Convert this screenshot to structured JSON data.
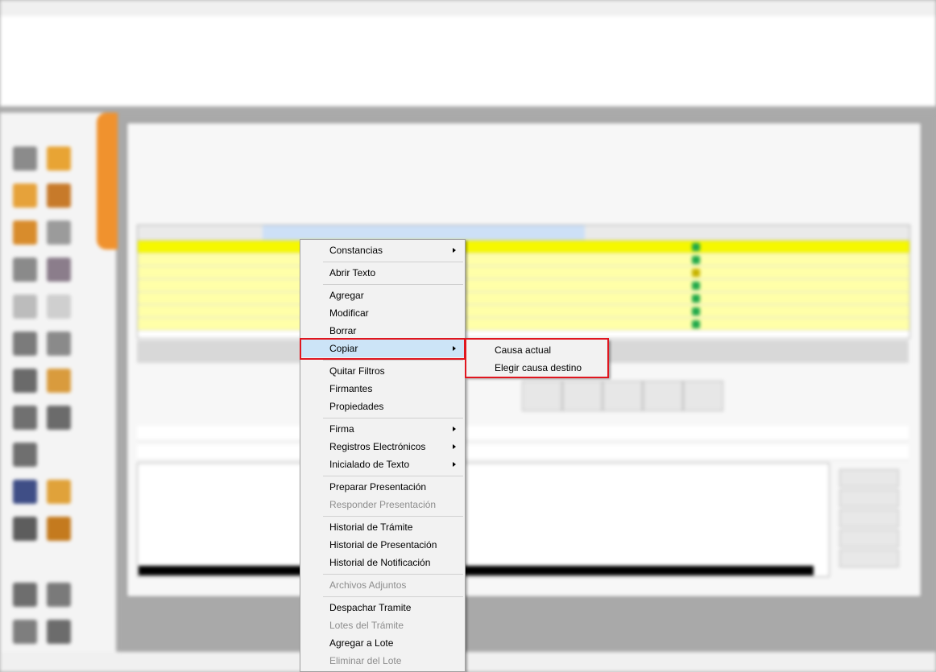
{
  "context_menu": {
    "items": [
      {
        "label": "Constancias",
        "submenu": true,
        "enabled": true
      },
      {
        "label": "Abrir Texto",
        "enabled": true
      },
      {
        "label": "Agregar",
        "enabled": true
      },
      {
        "label": "Modificar",
        "enabled": true
      },
      {
        "label": "Borrar",
        "enabled": true
      },
      {
        "label": "Copiar",
        "submenu": true,
        "enabled": true,
        "highlighted": true
      },
      {
        "label": "Quitar Filtros",
        "enabled": true
      },
      {
        "label": "Firmantes",
        "enabled": true
      },
      {
        "label": "Propiedades",
        "enabled": true
      },
      {
        "label": "Firma",
        "submenu": true,
        "enabled": true
      },
      {
        "label": "Registros Electrónicos",
        "submenu": true,
        "enabled": true
      },
      {
        "label": "Inicialado de Texto",
        "submenu": true,
        "enabled": true
      },
      {
        "label": "Preparar Presentación",
        "enabled": true
      },
      {
        "label": "Responder Presentación",
        "enabled": false
      },
      {
        "label": "Historial de Trámite",
        "enabled": true
      },
      {
        "label": "Historial de Presentación",
        "enabled": true
      },
      {
        "label": "Historial de Notificación",
        "enabled": true
      },
      {
        "label": "Archivos Adjuntos",
        "enabled": false
      },
      {
        "label": "Despachar Tramite",
        "enabled": true
      },
      {
        "label": "Lotes del Trámite",
        "enabled": false
      },
      {
        "label": "Agregar a Lote",
        "enabled": true
      },
      {
        "label": "Eliminar del Lote",
        "enabled": false
      }
    ]
  },
  "submenu_copiar": {
    "items": [
      {
        "label": "Causa actual"
      },
      {
        "label": "Elegir causa destino"
      }
    ]
  },
  "colors": {
    "highlight": "#cce4f7",
    "annotation_red": "#e0161f",
    "row_yellow": "#ffffa8",
    "status_green": "#1fa84a",
    "accent_orange": "#f0922e"
  }
}
